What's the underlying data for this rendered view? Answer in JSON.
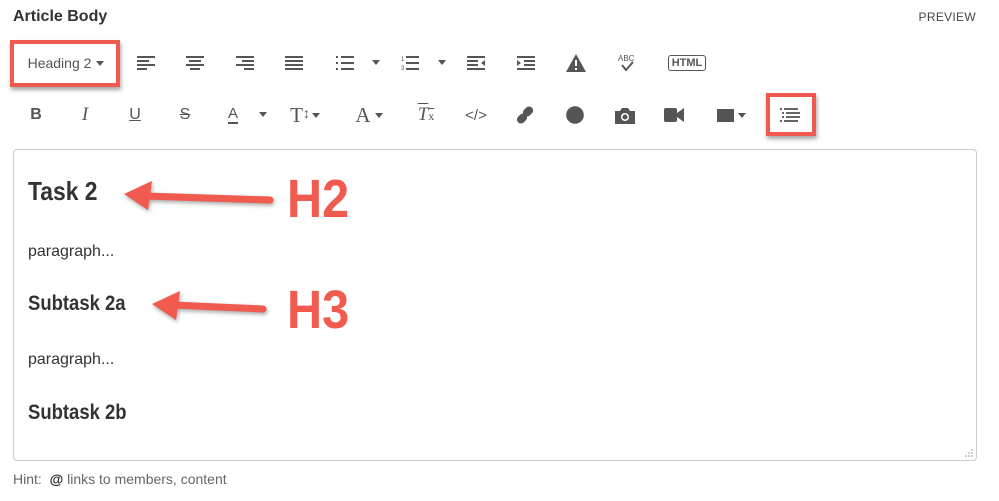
{
  "header": {
    "title": "Article Body",
    "preview_label": "PREVIEW"
  },
  "toolbar": {
    "format_select": "Heading 2",
    "html_label": "HTML",
    "spell_label": "ABC",
    "font_size_label": "T",
    "font_family_label": "A",
    "color_label": "A"
  },
  "content": {
    "h2": "Task 2",
    "p1": "paragraph...",
    "h3a": "Subtask 2a",
    "p2": "paragraph...",
    "h3b": "Subtask 2b"
  },
  "annotations": {
    "h2": "H2",
    "h3": "H3",
    "color": "#f05a4f"
  },
  "hint": {
    "label": "Hint:",
    "at": "@",
    "text": "links to members, content"
  }
}
